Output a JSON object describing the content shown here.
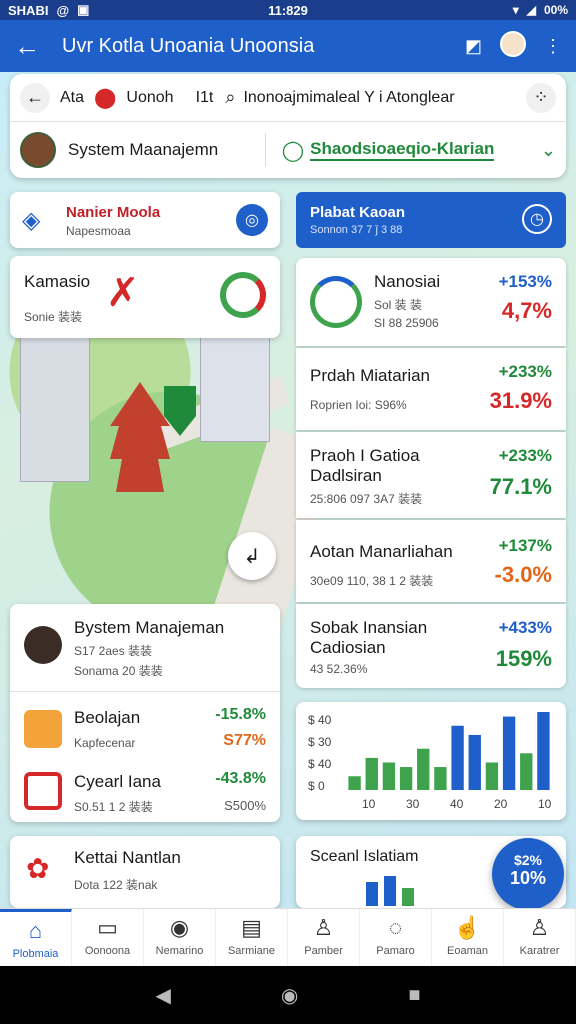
{
  "status_bar": {
    "left": "SHABI",
    "time": "11:829",
    "battery": "00%"
  },
  "app_bar": {
    "title": "Uvr Kotla Unoania Unoonsia"
  },
  "search": {
    "back": "Ata",
    "query": "Uonoh",
    "extra": "I1t",
    "text": "Inonoajmimaleal Y i Atonglear"
  },
  "system": {
    "label": "System Maanajemn",
    "link": "Shaodsioaeqio-Klarian"
  },
  "nav_card": {
    "title": "Nanier Moola",
    "subtitle": "Napesmoaa"
  },
  "blue_card": {
    "title": "Plabat Kaoan",
    "subtitle": "Sonnon 37 7 ǰ 3 88"
  },
  "kamasio": {
    "title": "Kamasio",
    "subtitle": "Sonie 装装"
  },
  "map_badge": "",
  "stats": [
    {
      "name": "Nanosiai",
      "sub1": "Sol 装 装",
      "sub2": "SI 88 25906",
      "p1": "+153%",
      "p2": "4,7%"
    },
    {
      "name": "Prdah Miatarian",
      "sub1": "Roprien Ioi: S96%",
      "sub2": "",
      "p1": "+233%",
      "p2": "31.9%"
    },
    {
      "name": "Praoh I Gatioa",
      "name2": "Dadlsiran",
      "sub1": "25:806 097 3A7 装装",
      "sub2": "",
      "p1": "+233%",
      "p2": "77.1%"
    },
    {
      "name": "Aotan Manarliahan",
      "sub1": "30e09 110, 38 1 2 装装",
      "sub2": "",
      "p1": "+137%",
      "p2": "-3.0%"
    },
    {
      "name": "Sobak Inansian",
      "name2": "Cadiosian",
      "sub1": "43 52.36%",
      "sub2": "",
      "p1": "+433%",
      "p2": "159%"
    }
  ],
  "profile": {
    "name": "Bystem Manajeman",
    "sub1": "S17 2aes 装装",
    "sub2": "Sonama 20 装装"
  },
  "people": [
    {
      "name": "Beolajan",
      "sub": "Kapfecenar",
      "p1": "-15.8%",
      "p2": "S77%"
    },
    {
      "name": "Cyearl Iana",
      "sub": "S0.51 1 2 装装",
      "p1": "-43.8%",
      "p2": "S500%"
    }
  ],
  "kettai": {
    "name": "Kettai Nantlan",
    "sub": "Dota 122 装nak"
  },
  "chart_data": {
    "type": "bar",
    "categories": [
      "",
      "",
      "",
      "",
      "",
      "",
      "",
      "",
      "",
      "",
      "",
      ""
    ],
    "values": [
      3,
      7,
      6,
      5,
      9,
      5,
      14,
      12,
      6,
      16,
      8,
      17
    ],
    "colors": [
      "#3fa34d",
      "#3fa34d",
      "#3fa34d",
      "#3fa34d",
      "#3fa34d",
      "#3fa34d",
      "#1f5fc9",
      "#1f5fc9",
      "#3fa34d",
      "#1f5fc9",
      "#3fa34d",
      "#1f5fc9"
    ],
    "yticks": [
      "$ 40",
      "$ 30",
      "$ 40",
      "$ 0"
    ],
    "xticks": [
      "10",
      "30",
      "40",
      "20",
      "10"
    ],
    "title": "",
    "xlabel": "",
    "ylabel": ""
  },
  "chart2": {
    "title": "Sceanl Islatiam"
  },
  "fab": {
    "l1": "$2%",
    "l2": "10%"
  },
  "bottom_nav": [
    "Plobmaia",
    "Oonoona",
    "Nemarino",
    "Sarmiane",
    "Pamber",
    "Pamaro",
    "Eoaman",
    "Karatrer"
  ]
}
